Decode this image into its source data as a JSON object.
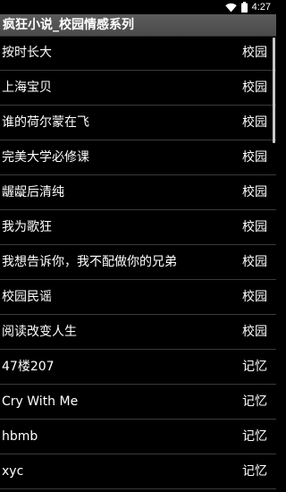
{
  "status_bar": {
    "time": "4:27",
    "icons": [
      "wifi-icon",
      "battery-icon"
    ]
  },
  "header": {
    "title": "疯狂小说_校园情感系列"
  },
  "list": {
    "items": [
      {
        "title": "按时长大",
        "category": "校园"
      },
      {
        "title": "上海宝贝",
        "category": "校园"
      },
      {
        "title": "谁的荷尔蒙在飞",
        "category": "校园"
      },
      {
        "title": "完美大学必修课",
        "category": "校园"
      },
      {
        "title": "龌龊后清纯",
        "category": "校园"
      },
      {
        "title": "我为歌狂",
        "category": "校园"
      },
      {
        "title": "我想告诉你，我不配做你的兄弟",
        "category": "校园"
      },
      {
        "title": "校园民谣",
        "category": "校园"
      },
      {
        "title": "阅读改变人生",
        "category": "校园"
      },
      {
        "title": "47楼207",
        "category": "记忆"
      },
      {
        "title": "Cry With Me",
        "category": "记忆"
      },
      {
        "title": "hbmb",
        "category": "记忆"
      },
      {
        "title": "xyc",
        "category": "记忆"
      }
    ]
  },
  "colors": {
    "background": "#000000",
    "title_bar": "#4f4f4f",
    "divider": "#3a3a3a",
    "text": "#ffffff"
  }
}
